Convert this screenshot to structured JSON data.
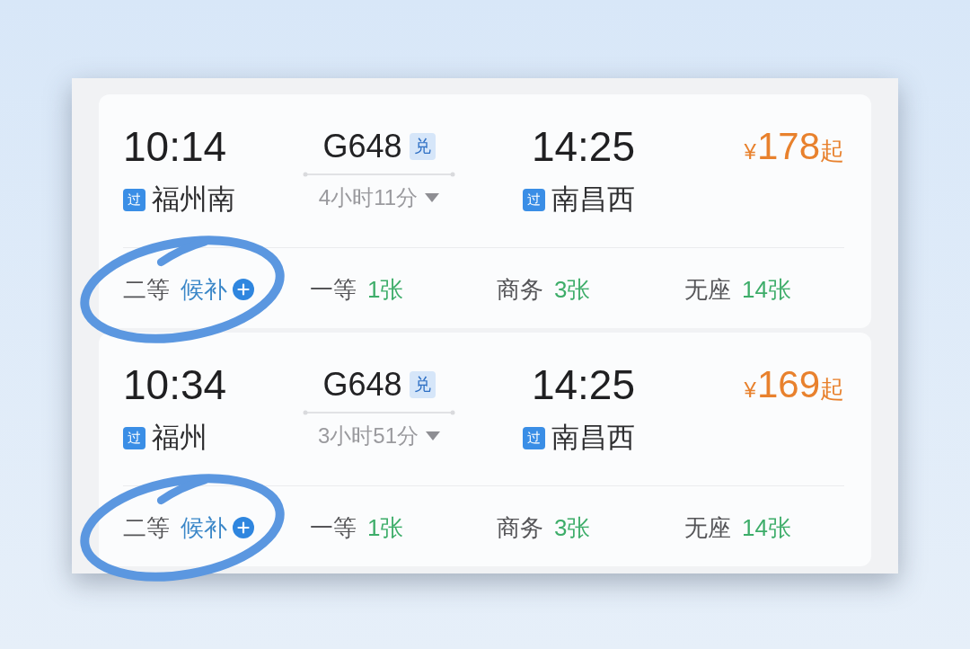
{
  "trains": [
    {
      "depart": {
        "time": "10:14",
        "tag": "过",
        "station": "福州南"
      },
      "train_no": "G648",
      "train_tag": "兑",
      "duration": "4小时11分",
      "arrive": {
        "time": "14:25",
        "tag": "过",
        "station": "南昌西"
      },
      "price": {
        "currency": "¥",
        "amount": "178",
        "suffix": "起"
      },
      "seats": [
        {
          "kind": "waitlist",
          "class": "二等",
          "status": "候补",
          "circled": true
        },
        {
          "kind": "count",
          "class": "一等",
          "status": "1张",
          "circled": false
        },
        {
          "kind": "count",
          "class": "商务",
          "status": "3张",
          "circled": false
        },
        {
          "kind": "count",
          "class": "无座",
          "status": "14张",
          "circled": false
        }
      ]
    },
    {
      "depart": {
        "time": "10:34",
        "tag": "过",
        "station": "福州"
      },
      "train_no": "G648",
      "train_tag": "兑",
      "duration": "3小时51分",
      "arrive": {
        "time": "14:25",
        "tag": "过",
        "station": "南昌西"
      },
      "price": {
        "currency": "¥",
        "amount": "169",
        "suffix": "起"
      },
      "seats": [
        {
          "kind": "waitlist",
          "class": "二等",
          "status": "候补",
          "circled": true
        },
        {
          "kind": "count",
          "class": "一等",
          "status": "1张",
          "circled": false
        },
        {
          "kind": "count",
          "class": "商务",
          "status": "3张",
          "circled": false
        },
        {
          "kind": "count",
          "class": "无座",
          "status": "14张",
          "circled": false
        }
      ]
    }
  ]
}
